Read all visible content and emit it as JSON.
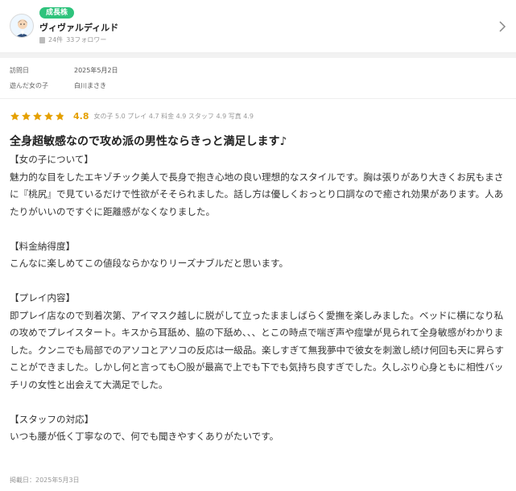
{
  "reviewer": {
    "badge": "成長株",
    "name": "ヴィヴァルディルド",
    "posts": "24件",
    "followers": "33フォロワー"
  },
  "meta": {
    "visit_label": "訪問日",
    "visit_value": "2025年5月2日",
    "girl_label": "遊んだ女の子",
    "girl_value": "白川まさき"
  },
  "rating": {
    "stars": 4.8,
    "score": "4.8",
    "subscores": "女の子 5.0 プレイ 4.7 料金 4.9 スタッフ 4.9 写真 4.9"
  },
  "review": {
    "title": "全身超敏感なので攻め派の男性ならきっと満足します♪",
    "body": "【女の子について】\n魅力的な目をしたエキゾチック美人で長身で抱き心地の良い理想的なスタイルです。胸は張りがあり大きくお尻もまさに『桃尻』で見ているだけで性欲がそそられました。話し方は優しくおっとり口調なので癒され効果があります。人あたりがいいのですぐに距離感がなくなりました。\n\n【料金納得度】\nこんなに楽しめてこの値段ならかなりリーズナブルだと思います。\n\n【プレイ内容】\n即プレイ店なので到着次第、アイマスク越しに脱がして立ったまましばらく愛撫を楽しみました。ベッドに横になり私の攻めでプレイスタート。キスから耳舐め、脇の下舐め、、、とこの時点で喘ぎ声や痙攣が見られて全身敏感がわかりました。クンニでも局部でのアソコとアソコの反応は一級品。楽しすぎて無我夢中で彼女を刺激し続け何回も天に昇らすことができました。しかし何と言っても〇股が最高で上でも下でも気持ち良すぎでした。久しぶり心身ともに相性バッチリの女性と出会えて大満足でした。\n\n【スタッフの対応】\nいつも腰が低く丁寧なので、何でも聞きやすくありがたいです。",
    "posted": "掲載日：2025年5月3日"
  },
  "colors": {
    "badge": "#2ec37c",
    "star": "#e5a000"
  }
}
